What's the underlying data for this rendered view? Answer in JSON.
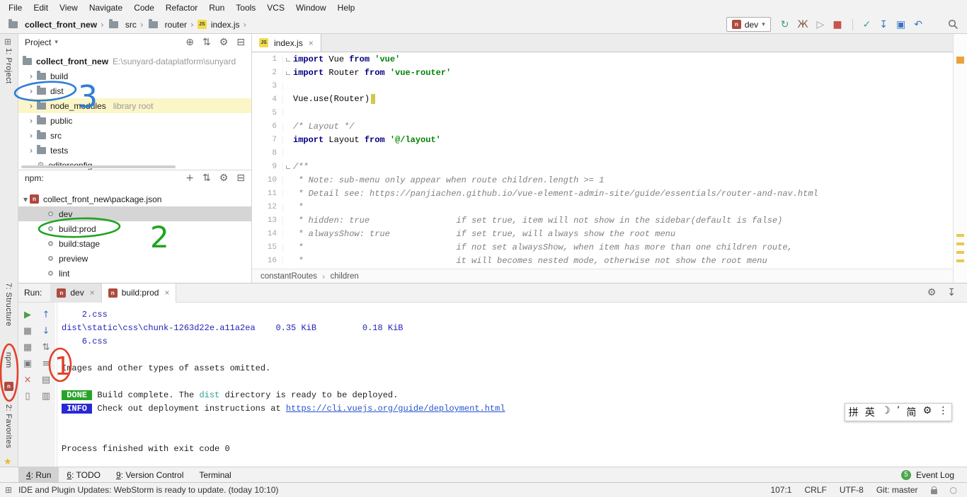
{
  "colors": {
    "annotation_blue": "#2F7CD8",
    "annotation_green": "#1FA41F",
    "annotation_red": "#E3402B",
    "badge_done_bg": "#27A327",
    "badge_info_bg": "#2929D4",
    "console_blue": "#2323B8",
    "string_green": "#008000",
    "keyword_navy": "#000080",
    "highlight_yellow": "#FBF6C8"
  },
  "menu": {
    "items": [
      "File",
      "Edit",
      "View",
      "Navigate",
      "Code",
      "Refactor",
      "Run",
      "Tools",
      "VCS",
      "Window",
      "Help"
    ]
  },
  "navbar": {
    "breadcrumb": [
      "collect_front_new",
      "src",
      "router",
      "index.js"
    ],
    "run_config": "dev",
    "icons_run": [
      {
        "name": "rerun",
        "glyph": "↻",
        "color": "#3A9E77"
      },
      {
        "name": "debug",
        "glyph": "Ж",
        "color": "#8A5A44"
      },
      {
        "name": "run-with-coverage",
        "glyph": "▷",
        "color": "#9A9A9A"
      },
      {
        "name": "stop",
        "glyph": "■",
        "color": "#C75450"
      }
    ],
    "icons_vcs": [
      {
        "name": "commit",
        "glyph": "✓",
        "color": "#3A9E9E"
      },
      {
        "name": "update-project",
        "glyph": "↧",
        "color": "#3A76C4"
      },
      {
        "name": "shelve",
        "glyph": "▣",
        "color": "#3A76C4"
      },
      {
        "name": "rollback",
        "glyph": "↶",
        "color": "#3A76C4"
      }
    ]
  },
  "left_strip": {
    "project": "1: Project",
    "structure": "7: Structure",
    "npm": "npm",
    "favorites": "2: Favorites"
  },
  "project_panel": {
    "title": "Project",
    "header_icons": [
      {
        "name": "locate",
        "glyph": "⊕",
        "color": "#666666"
      },
      {
        "name": "collapse-all",
        "glyph": "⇅",
        "color": "#666666"
      },
      {
        "name": "settings",
        "glyph": "⚙",
        "color": "#666666"
      },
      {
        "name": "hide",
        "glyph": "⊟",
        "color": "#666666"
      }
    ],
    "root_name": "collect_front_new",
    "root_path": "E:\\sunyard-dataplatform\\sunyard",
    "folders": [
      {
        "name": "build"
      },
      {
        "name": "dist"
      },
      {
        "name": "node_modules",
        "suffix": "library root",
        "highlight": true
      },
      {
        "name": "public"
      },
      {
        "name": "src"
      },
      {
        "name": "tests"
      }
    ],
    "files": [
      {
        "name": ".editorconfig"
      }
    ]
  },
  "npm_panel": {
    "title": "npm:",
    "header_icons": [
      {
        "name": "add",
        "glyph": "+",
        "color": "#666666"
      },
      {
        "name": "collapse-all",
        "glyph": "⇅",
        "color": "#666666"
      },
      {
        "name": "settings",
        "glyph": "⚙",
        "color": "#666666"
      },
      {
        "name": "hide",
        "glyph": "⊟",
        "color": "#666666"
      }
    ],
    "package": "collect_front_new\\package.json",
    "scripts": [
      {
        "name": "dev",
        "selected": true
      },
      {
        "name": "build:prod"
      },
      {
        "name": "build:stage"
      },
      {
        "name": "preview"
      },
      {
        "name": "lint"
      }
    ]
  },
  "editor": {
    "tab": "index.js",
    "breadcrumb": [
      "constantRoutes",
      "children"
    ],
    "lines": [
      {
        "n": "1",
        "f": 1,
        "t": [
          [
            "k",
            "import"
          ],
          [
            "p",
            " Vue "
          ],
          [
            "k",
            "from"
          ],
          [
            "p",
            " "
          ],
          [
            "s",
            "'vue'"
          ]
        ]
      },
      {
        "n": "2",
        "f": 1,
        "t": [
          [
            "k",
            "import"
          ],
          [
            "p",
            " Router "
          ],
          [
            "k",
            "from"
          ],
          [
            "p",
            " "
          ],
          [
            "s",
            "'vue-router'"
          ]
        ]
      },
      {
        "n": "3",
        "t": []
      },
      {
        "n": "4",
        "caret": true,
        "t": [
          [
            "p",
            "Vue.use(Router)"
          ]
        ]
      },
      {
        "n": "5",
        "t": []
      },
      {
        "n": "6",
        "t": [
          [
            "c",
            "/* Layout */"
          ]
        ]
      },
      {
        "n": "7",
        "t": [
          [
            "k",
            "import"
          ],
          [
            "p",
            " Layout "
          ],
          [
            "k",
            "from"
          ],
          [
            "p",
            " "
          ],
          [
            "s",
            "'@/layout'"
          ]
        ]
      },
      {
        "n": "8",
        "t": []
      },
      {
        "n": "9",
        "f": 1,
        "t": [
          [
            "c",
            "/**"
          ]
        ]
      },
      {
        "n": "10",
        "t": [
          [
            "c",
            " * Note: sub-menu only appear when route children.length >= 1"
          ]
        ]
      },
      {
        "n": "11",
        "t": [
          [
            "c",
            " * Detail see: https://panjiachen.github.io/vue-element-admin-site/guide/essentials/router-and-nav.html"
          ]
        ]
      },
      {
        "n": "12",
        "t": [
          [
            "c",
            " *"
          ]
        ]
      },
      {
        "n": "13",
        "t": [
          [
            "c",
            " * hidden: true                 if set true, item will not show in the sidebar(default is false)"
          ]
        ]
      },
      {
        "n": "14",
        "t": [
          [
            "c",
            " * alwaysShow: true             if set true, will always show the root menu"
          ]
        ]
      },
      {
        "n": "15",
        "t": [
          [
            "c",
            " *                              if not set alwaysShow, when item has more than one children route,"
          ]
        ]
      },
      {
        "n": "16",
        "t": [
          [
            "c",
            " *                              it will becomes nested mode, otherwise not show the root menu"
          ]
        ]
      }
    ]
  },
  "run_panel": {
    "label": "Run:",
    "tabs": [
      {
        "name": "dev"
      },
      {
        "name": "build:prod",
        "selected": true
      }
    ],
    "tab_icons": [
      {
        "name": "settings",
        "glyph": "⚙",
        "color": "#666666"
      },
      {
        "name": "dock",
        "glyph": "↧",
        "color": "#666666"
      }
    ],
    "toolbar_run": [
      {
        "name": "rerun",
        "glyph": "▶",
        "color": "#4C9B4C"
      },
      {
        "name": "stop",
        "glyph": "■",
        "color": "#9E9E9E"
      },
      {
        "name": "restore-layout",
        "glyph": "▦",
        "color": "#76797C"
      },
      {
        "name": "pin-tab",
        "glyph": "▣",
        "color": "#76797C"
      },
      {
        "name": "close",
        "glyph": "×",
        "color": "#D05050"
      },
      {
        "name": "clear",
        "glyph": "▯",
        "color": "#76797C"
      }
    ],
    "toolbar_console": [
      {
        "name": "up-stack-trace",
        "glyph": "↑",
        "color": "#3A76C4"
      },
      {
        "name": "down-stack-trace",
        "glyph": "↓",
        "color": "#3A76C4"
      },
      {
        "name": "soft-wrap",
        "glyph": "⇅",
        "color": "#76797C"
      },
      {
        "name": "scroll-to-end",
        "glyph": "≡",
        "color": "#76797C"
      },
      {
        "name": "print",
        "glyph": "▤",
        "color": "#76797C"
      },
      {
        "name": "clear-all",
        "glyph": "▥",
        "color": "#76797C"
      }
    ],
    "console": [
      [
        [
          "blue",
          "    2.css"
        ]
      ],
      [
        [
          "blue",
          "dist\\static\\css\\chunk-1263d22e.a11a2ea    0.35 KiB         0.18 KiB"
        ]
      ],
      [
        [
          "blue",
          "    6.css"
        ]
      ],
      [],
      [
        [
          "black",
          "Images and other types of assets omitted."
        ]
      ],
      [],
      [
        [
          "badge-done",
          " DONE "
        ],
        [
          "black",
          " Build complete. The "
        ],
        [
          "teal",
          "dist"
        ],
        [
          "black",
          " directory is ready to be deployed."
        ]
      ],
      [
        [
          "badge-info",
          " INFO "
        ],
        [
          "black",
          " Check out deployment instructions at "
        ],
        [
          "link",
          "https://cli.vuejs.org/guide/deployment.html"
        ]
      ],
      [],
      [],
      [
        [
          "black",
          "Process finished with exit code 0"
        ]
      ]
    ]
  },
  "bottom_bar": {
    "tabs": [
      {
        "key": "4",
        "label": "Run",
        "active": true
      },
      {
        "key": "6",
        "label": "TODO"
      },
      {
        "key": "9",
        "label": "Version Control"
      },
      {
        "label": "Terminal"
      }
    ],
    "event_log": "Event Log",
    "event_count": "5"
  },
  "status_bar": {
    "message": "IDE and Plugin Updates: WebStorm is ready to update. (today 10:10)",
    "caret": "107:1",
    "line_sep": "CRLF",
    "encoding": "UTF-8",
    "git": "Git: master"
  },
  "ime": {
    "items": [
      "拼",
      "英",
      "☽",
      "’",
      "简",
      "⚙",
      "⋮"
    ]
  },
  "annotations": [
    {
      "n": "1"
    },
    {
      "n": "2"
    },
    {
      "n": "3"
    }
  ]
}
